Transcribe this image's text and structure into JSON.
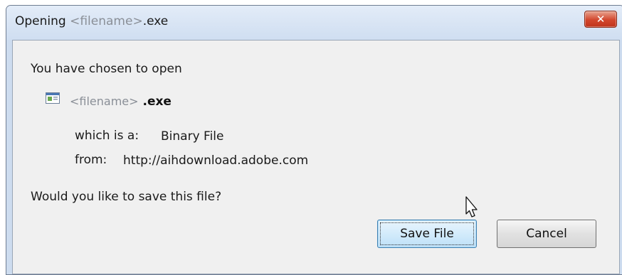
{
  "dialog": {
    "title_prefix": "Opening ",
    "title_filename": "<filename>",
    "title_ext": ".exe",
    "close_label": "✕",
    "heading": "You have chosen to open",
    "file_name": "<filename>",
    "file_ext": " .exe",
    "which_is_label": "which is a:",
    "file_type": "Binary File",
    "from_label": "from:",
    "source_url": "http://aihdownload.adobe.com",
    "question": "Would you like to save this file?",
    "save_button_label": "Save File",
    "cancel_button_label": "Cancel"
  },
  "icons": {
    "close": "close-icon",
    "file": "executable-file-icon",
    "cursor": "mouse-pointer-icon"
  },
  "colors": {
    "titlebar": "#cfdef1",
    "close_button": "#d2462d",
    "default_button_border": "#3c7fb1",
    "placeholder_text": "#8a8f97"
  }
}
